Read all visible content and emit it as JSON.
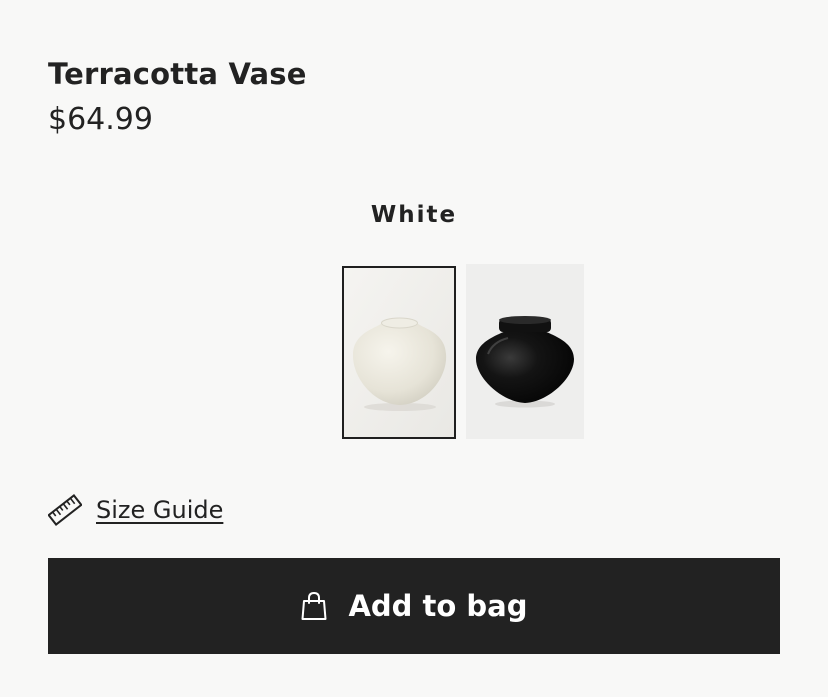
{
  "product": {
    "title": "Terracotta Vase",
    "price": "$64.99"
  },
  "color": {
    "selected_label": "White",
    "swatches": [
      {
        "name": "White",
        "selected": true,
        "image": "white vase thumbnail"
      },
      {
        "name": "Black",
        "selected": false,
        "image": "black vase thumbnail"
      }
    ]
  },
  "size_guide": {
    "label": "Size Guide",
    "icon": "ruler-icon"
  },
  "cart": {
    "add_label": "Add to bag",
    "icon": "shopping-bag-icon"
  },
  "colors": {
    "background": "#f8f8f7",
    "text": "#222222",
    "button_bg": "#222222",
    "button_text": "#ffffff"
  }
}
